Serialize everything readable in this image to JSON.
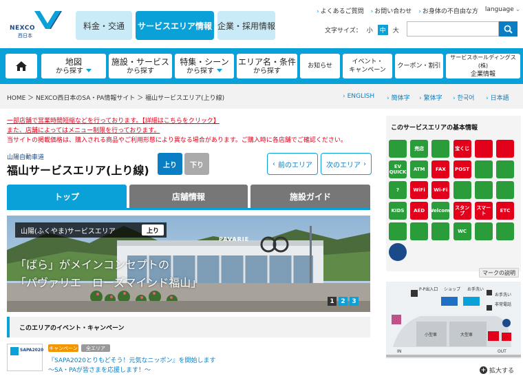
{
  "brand": {
    "name": "NEXCO",
    "sub": "西日本"
  },
  "global_tabs": [
    "料金・交通",
    "サービスエリア情報",
    "企業・採用情報"
  ],
  "utility_links": [
    "よくあるご質問",
    "お問い合わせ",
    "お身体の不自由な方",
    "language"
  ],
  "font_size": {
    "label": "文字サイズ：",
    "options": [
      "小",
      "中",
      "大"
    ],
    "selected": "中"
  },
  "search": {
    "placeholder": ""
  },
  "nav": [
    {
      "a": "地図",
      "b": "から探す",
      "dropdown": true
    },
    {
      "a": "施設・サービス",
      "b": "から探す",
      "dropdown": false
    },
    {
      "a": "特集・シーン",
      "b": "から探す",
      "dropdown": true
    },
    {
      "a": "エリア名・条件",
      "b": "から探す",
      "dropdown": false
    },
    {
      "a": "お知らせ",
      "b": "",
      "dropdown": false
    },
    {
      "a": "イベント・",
      "b": "キャンペーン",
      "dropdown": false
    },
    {
      "a": "クーポン・割引",
      "b": "",
      "dropdown": false
    },
    {
      "a": "サービスホールディングス(株)",
      "b": "企業情報",
      "dropdown": false
    }
  ],
  "breadcrumb": "HOME ＞ NEXCO西日本のSA・PA情報サイト ＞ 福山サービスエリア(上り線)",
  "languages": [
    "ENGLISH",
    "簡体字",
    "繁体字",
    "한국어",
    "日本語"
  ],
  "notices": [
    "一部店舗で営業時間短縮などを行っております。【詳細はこちらをクリック】",
    "また、店舗によってはメニュー制限を行っております。",
    "当サイトの掲載価格は、購入される商品やご利用形態により異なる場合があります。ご購入時に各店舗でご確認ください。"
  ],
  "route": "山陽自動車道",
  "page_title": "福山サービスエリア(上り線)",
  "direction": {
    "up": "上り",
    "down": "下り"
  },
  "area_nav": {
    "prev": "前のエリア",
    "next": "次のエリア"
  },
  "tabs": [
    "トップ",
    "店舗情報",
    "施設ガイド"
  ],
  "hero": {
    "area_label": "山陽(ふくやま)サービスエリア",
    "badge": "上り",
    "copy_line1": "「ばら」がメインコンセプトの",
    "copy_line2": "「パヴァリエ　ローズマインド福山」",
    "sign": "PAVARIE",
    "pages": [
      "1",
      "2",
      "3"
    ],
    "current_page": 1
  },
  "events": {
    "heading": "このエリアのイベント・キャンペーン",
    "item": {
      "thumb_text": "SAPA2020",
      "tags": [
        "キャンペーン",
        "全エリア"
      ],
      "title1": "『SAPA2020とりもどそう！元気なニッポン』を開始します",
      "title2": "〜SA・PAが皆さまを応援します！〜"
    }
  },
  "sidebar": {
    "title": "このサービスエリアの基本情報",
    "icons": [
      {
        "name": "restroom-icon",
        "label": "",
        "color": "#2a9d3a"
      },
      {
        "name": "shop-icon",
        "label": "売店",
        "color": "#2a9d3a"
      },
      {
        "name": "shopping-icon",
        "label": "",
        "color": "#2a9d3a"
      },
      {
        "name": "lottery-icon",
        "label": "宝くじ",
        "color": "#e3001b"
      },
      {
        "name": "rose-icon",
        "label": "",
        "color": "#e3001b"
      },
      {
        "name": "ubara-icon",
        "label": "",
        "color": "#e3001b"
      },
      {
        "name": "ev-quick-icon",
        "label": "EV QUICK",
        "color": "#2a9d3a"
      },
      {
        "name": "atm-icon",
        "label": "ATM",
        "color": "#2a9d3a"
      },
      {
        "name": "fax-icon",
        "label": "FAX",
        "color": "#e3001b"
      },
      {
        "name": "post-icon",
        "label": "POST",
        "color": "#e3001b"
      },
      {
        "name": "card-icon",
        "label": "",
        "color": "#2a9d3a"
      },
      {
        "name": "highway-info-icon",
        "label": "",
        "color": "#2a9d3a"
      },
      {
        "name": "info-icon",
        "label": "?",
        "color": "#2a9d3a"
      },
      {
        "name": "wifi-icon",
        "label": "WiFi",
        "color": "#e3001b"
      },
      {
        "name": "wifi-spot-icon",
        "label": "Wi-Fi",
        "color": "#e3001b"
      },
      {
        "name": "highway-info-2-icon",
        "label": "",
        "color": "#2a9d3a"
      },
      {
        "name": "dog-run-icon",
        "label": "",
        "color": "#2a9d3a"
      },
      {
        "name": "cart-icon",
        "label": "",
        "color": "#2a9d3a"
      },
      {
        "name": "kids-icon",
        "label": "KIDS",
        "color": "#2a9d3a"
      },
      {
        "name": "aed-icon",
        "label": "AED",
        "color": "#e3001b"
      },
      {
        "name": "welcome-icon",
        "label": "Welcome",
        "color": "#2a9d3a"
      },
      {
        "name": "stamp-icon",
        "label": "スタンプ",
        "color": "#e3001b"
      },
      {
        "name": "smart-ic-icon",
        "label": "スマート",
        "color": "#e3001b"
      },
      {
        "name": "etc-icon",
        "label": "ETC",
        "color": "#e3001b"
      },
      {
        "name": "baby-icon",
        "label": "",
        "color": "#2a9d3a"
      },
      {
        "name": "nursing-icon",
        "label": "",
        "color": "#2a9d3a"
      },
      {
        "name": "wheelchair-icon",
        "label": "",
        "color": "#2a9d3a"
      },
      {
        "name": "accessible-wc-icon",
        "label": "WC",
        "color": "#2a9d3a"
      },
      {
        "name": "staff-icon",
        "label": "",
        "color": "#2a9d3a"
      },
      {
        "name": "rest-icon",
        "label": "",
        "color": "#2a9d3a"
      },
      {
        "name": "mascot-icon",
        "label": "",
        "color": "#1a4a8a"
      }
    ],
    "mark_button": "マークの説明",
    "map": {
      "labels": [
        "P-P出入口",
        "ショップ",
        "お手洗い",
        "お手洗い",
        "非常電話",
        "小型車",
        "大型車",
        "IN",
        "OUT"
      ]
    },
    "zoom": "拡大する"
  }
}
